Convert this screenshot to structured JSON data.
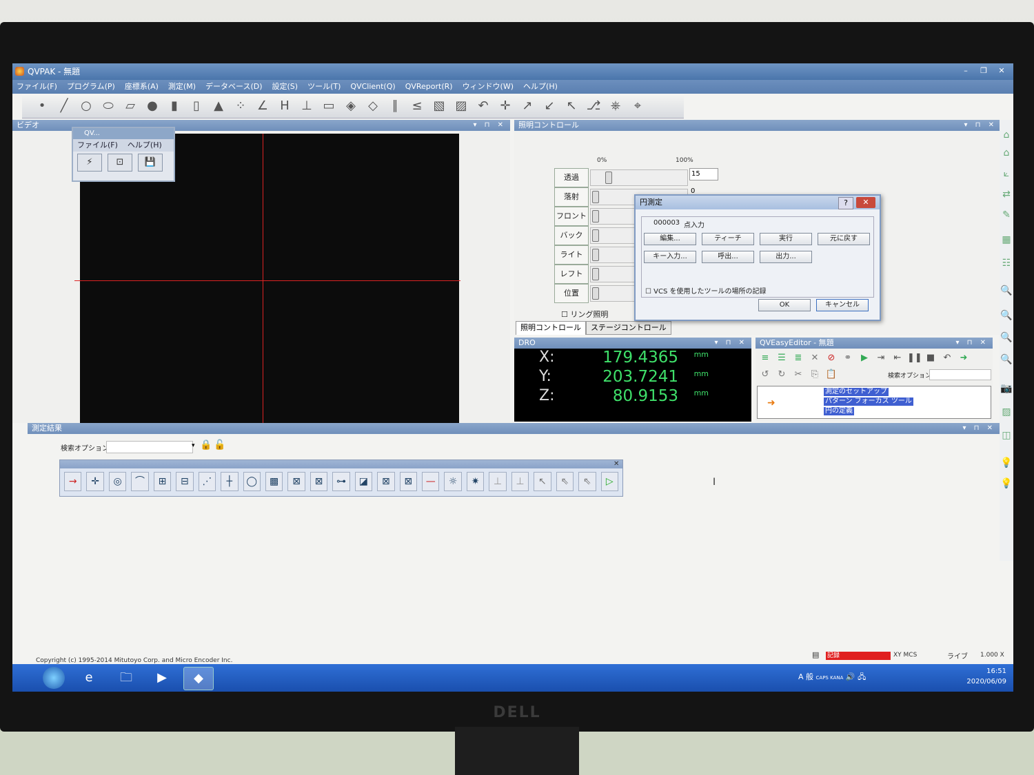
{
  "window": {
    "title": "QVPAK - 無題",
    "controls": [
      "–",
      "❐",
      "✕"
    ]
  },
  "menu": [
    "ファイル(F)",
    "プログラム(P)",
    "座標系(A)",
    "測定(M)",
    "データベース(D)",
    "設定(S)",
    "ツール(T)",
    "QVClient(Q)",
    "QVReport(R)",
    "ウィンドウ(W)",
    "ヘルプ(H)"
  ],
  "panels": {
    "video": "ビデオ",
    "lighting": "照明コントロール",
    "dro": "DRO",
    "easy_editor": "QVEasyEditor - 無題",
    "results": "測定結果"
  },
  "qv_mini": {
    "title": "QV...",
    "menu": [
      "ファイル(F)",
      "ヘルプ(H)"
    ]
  },
  "lighting": {
    "scale_min": "0%",
    "scale_max": "100%",
    "rows": [
      {
        "label": "透過",
        "value": "15",
        "level": 0.15
      },
      {
        "label": "落射",
        "value": "0",
        "level": 0
      },
      {
        "label": "フロント",
        "level": 0
      },
      {
        "label": "バック",
        "level": 0
      },
      {
        "label": "ライト",
        "level": 0
      },
      {
        "label": "レフト",
        "level": 0
      },
      {
        "label": "位置",
        "level": 0
      }
    ],
    "ring_label": "リング照明",
    "tabs": [
      "照明コントロール",
      "ステージコントロール"
    ]
  },
  "dialog": {
    "title": "円測定",
    "help": "?",
    "close": "✕",
    "step_id": "000003",
    "step_label": "点入力",
    "buttons_row1": [
      "編集...",
      "ティーチ",
      "実行",
      "元に戻す"
    ],
    "buttons_row2": [
      "キー入力...",
      "呼出...",
      "出力..."
    ],
    "checkbox_label": "VCS を使用したツールの場所の記録",
    "ok": "OK",
    "cancel": "キャンセル"
  },
  "dro": {
    "rows": [
      {
        "axis": "X:",
        "value": "179.4365",
        "unit": "mm"
      },
      {
        "axis": "Y:",
        "value": "203.7241",
        "unit": "mm"
      },
      {
        "axis": "Z:",
        "value": "80.9153",
        "unit": "mm"
      }
    ]
  },
  "easy_editor": {
    "search_label": "検索オプション:",
    "tree_items": [
      "測定のセットアップ",
      "パターン フォーカス ツール",
      "円の定義"
    ]
  },
  "results": {
    "search_label": "検索オプション:"
  },
  "footer": {
    "copyright": "Copyright (c) 1995-2014 Mitutoyo Corp. and Micro Encoder Inc.",
    "record": "記録",
    "coord": "XY MCS",
    "mode": "ライブ",
    "zoom": "1.000 X"
  },
  "taskbar": {
    "time": "16:51",
    "date": "2020/06/09",
    "ime": "A 般",
    "caps": "CAPS KANA"
  },
  "brand": "DELL",
  "colors": {
    "dro_digits": "#3fe06a",
    "crosshair": "#dd2222",
    "record": "#e02020"
  }
}
